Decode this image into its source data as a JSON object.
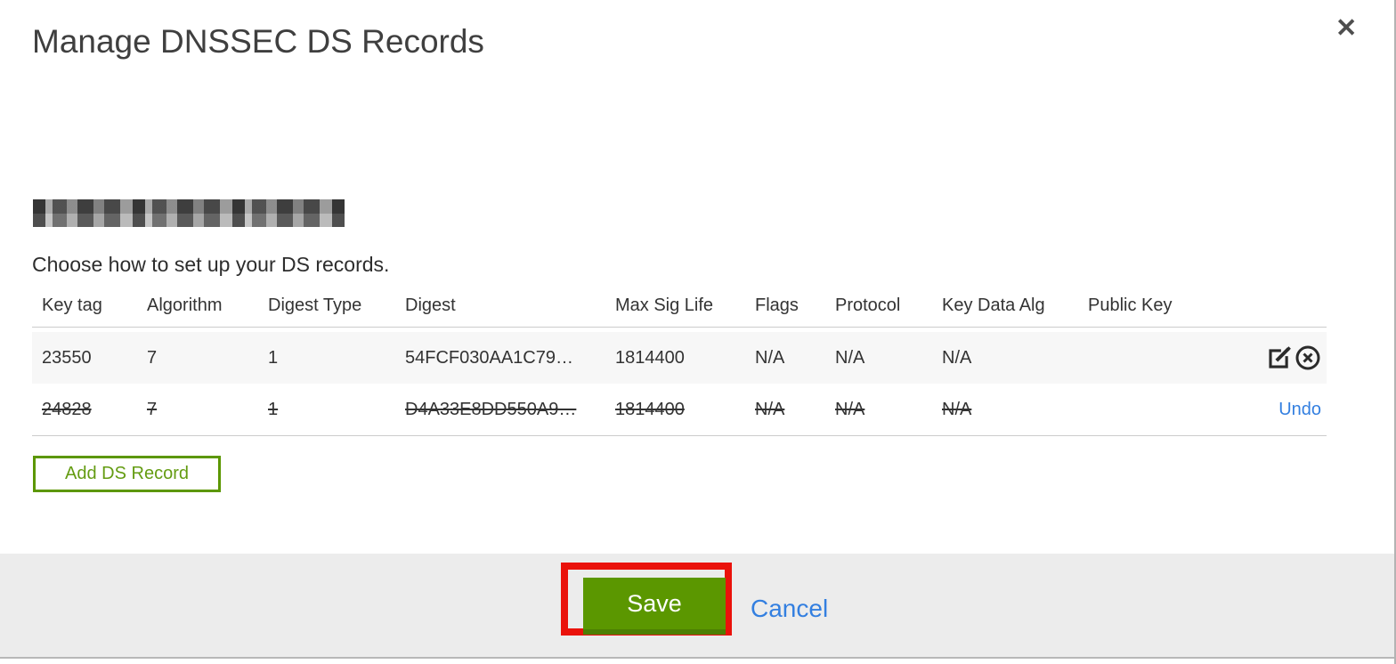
{
  "icons": {
    "close": "✕"
  },
  "colors": {
    "accent_green": "#5b9700",
    "green_button_shadow": "#4c7f03",
    "link_blue": "#337fe0",
    "annotation_red": "#ea120b",
    "footer_gray": "#ececec",
    "row_stripe_gray": "#f7f7f7"
  },
  "modal": {
    "title": "Manage DNSSEC DS Records",
    "instruction": "Choose how to set up your DS records.",
    "domain_name_redacted": "(pixelated domain name)",
    "table": {
      "columns": [
        "Key tag",
        "Algorithm",
        "Digest Type",
        "Digest",
        "Max Sig Life",
        "Flags",
        "Protocol",
        "Key Data Alg",
        "Public Key"
      ],
      "rows": [
        {
          "key_tag": "23550",
          "algorithm": "7",
          "digest_type": "1",
          "digest": "54FCF030AA1C79…",
          "max_sig_life": "1814400",
          "flags": "N/A",
          "protocol": "N/A",
          "key_data_alg": "N/A",
          "public_key": "",
          "state": "normal"
        },
        {
          "key_tag": "24828",
          "algorithm": "7",
          "digest_type": "1",
          "digest": "D4A33E8DD550A9…",
          "max_sig_life": "1814400",
          "flags": "N/A",
          "protocol": "N/A",
          "key_data_alg": "N/A",
          "public_key": "",
          "state": "deleted",
          "undo_label": "Undo"
        }
      ]
    },
    "add_button_label": "Add DS Record",
    "footer": {
      "save_label": "Save",
      "cancel_label": "Cancel"
    }
  }
}
